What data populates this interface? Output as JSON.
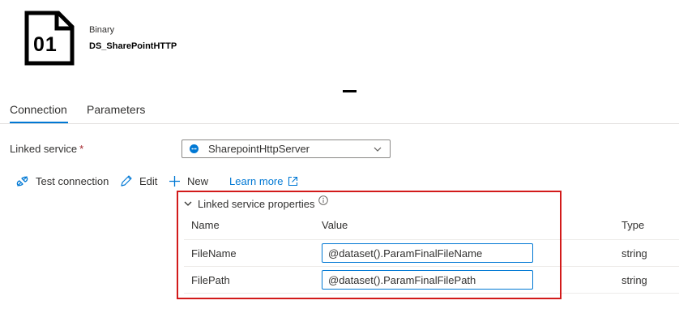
{
  "header": {
    "icon_text": "01",
    "dataset_type": "Binary",
    "dataset_name": "DS_SharePointHTTP"
  },
  "tabs": [
    {
      "label": "Connection",
      "active": true
    },
    {
      "label": "Parameters",
      "active": false
    }
  ],
  "linked_service": {
    "label": "Linked service",
    "required_marker": "*",
    "selected": "SharepointHttpServer"
  },
  "toolbar": {
    "test_connection": "Test connection",
    "edit": "Edit",
    "new": "New",
    "learn_more": "Learn more"
  },
  "properties": {
    "title": "Linked service properties",
    "columns": {
      "name": "Name",
      "value": "Value",
      "type": "Type"
    },
    "rows": [
      {
        "name": "FileName",
        "value": "@dataset().ParamFinalFileName",
        "type": "string"
      },
      {
        "name": "FilePath",
        "value": "@dataset().ParamFinalFilePath",
        "type": "string"
      }
    ]
  },
  "colors": {
    "accent": "#0078d4",
    "highlight_border": "#d21a1a",
    "required": "#a4262c"
  },
  "icons": [
    "binary-file-icon",
    "linked-service-dot-icon",
    "chevron-down-icon",
    "test-connection-icon",
    "edit-pencil-icon",
    "plus-icon",
    "external-link-icon",
    "info-icon"
  ]
}
